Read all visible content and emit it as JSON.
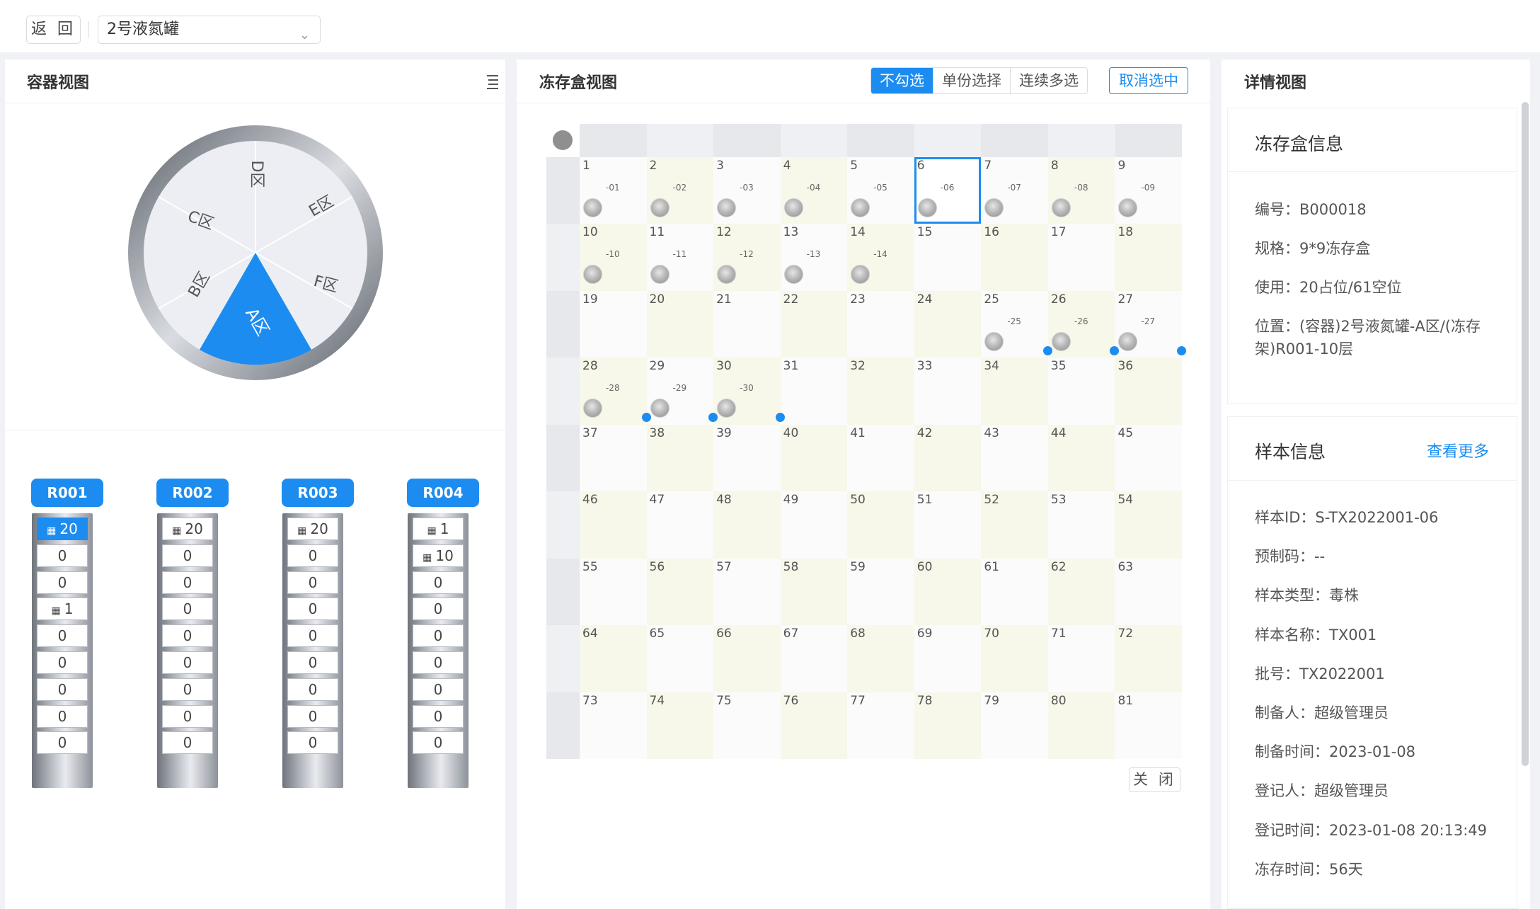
{
  "topbar": {
    "back_label": "返 回",
    "tank_select": "2号液氮罐"
  },
  "left": {
    "title": "容器视图",
    "sectors": [
      "A区",
      "B区",
      "C区",
      "D区",
      "E区",
      "F区"
    ],
    "racks": [
      {
        "label": "R001",
        "cells": [
          "20",
          "0",
          "0",
          "1",
          "0",
          "0",
          "0",
          "0",
          "0"
        ],
        "boxed": [
          0,
          3
        ],
        "selected": 0
      },
      {
        "label": "R002",
        "cells": [
          "20",
          "0",
          "0",
          "0",
          "0",
          "0",
          "0",
          "0",
          "0"
        ],
        "boxed": [
          0
        ],
        "selected": -1
      },
      {
        "label": "R003",
        "cells": [
          "20",
          "0",
          "0",
          "0",
          "0",
          "0",
          "0",
          "0",
          "0"
        ],
        "boxed": [
          0
        ],
        "selected": -1
      },
      {
        "label": "R004",
        "cells": [
          "1",
          "10",
          "0",
          "0",
          "0",
          "0",
          "0",
          "0",
          "0"
        ],
        "boxed": [
          0,
          1
        ],
        "selected": -1
      }
    ]
  },
  "middle": {
    "title": "冻存盒视图",
    "modes": [
      "不勾选",
      "单份选择",
      "连续多选"
    ],
    "active_mode": 0,
    "cancel_label": "取消选中",
    "close_label": "关 闭",
    "occupied": {
      "1": "-01",
      "2": "-02",
      "3": "-03",
      "4": "-04",
      "5": "-05",
      "6": "-06",
      "7": "-07",
      "8": "-08",
      "9": "-09",
      "10": "-10",
      "11": "-11",
      "12": "-12",
      "13": "-13",
      "14": "-14",
      "25": "-25",
      "26": "-26",
      "27": "-27",
      "28": "-28",
      "29": "-29",
      "30": "-30"
    },
    "dotted": [
      25,
      26,
      27,
      28,
      29,
      30
    ],
    "selected_cell": 6,
    "colors": {
      "accent": "#1c8cf0",
      "cream": "#f7f7ea",
      "light": "#fbfbfb",
      "header": "#e6e8ec"
    }
  },
  "right": {
    "title": "详情视图",
    "box_card": {
      "title": "冻存盒信息",
      "rows": [
        "编号：B000018",
        "规格：9*9冻存盒",
        "使用：20占位/61空位",
        "位置：(容器)2号液氮罐-A区/(冻存架)R001-10层"
      ]
    },
    "sample_card": {
      "title": "样本信息",
      "more": "查看更多",
      "rows": [
        "样本ID：S-TX2022001-06",
        "预制码：--",
        "样本类型：毒株",
        "样本名称：TX001",
        "批号：TX2022001",
        "制备人：超级管理员",
        "制备时间：2023-01-08",
        "登记人：超级管理员",
        "登记时间：2023-01-08 20:13:49",
        "冻存时间：56天"
      ]
    }
  }
}
